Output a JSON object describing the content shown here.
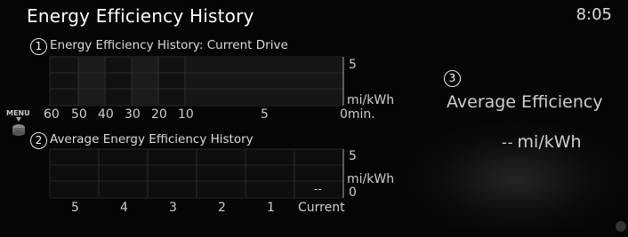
{
  "header": {
    "title": "Energy Efficiency History",
    "clock": "8:05"
  },
  "menu": {
    "label": "MENU",
    "icon": "commander-knob-icon"
  },
  "current_drive": {
    "badge": "1",
    "title": "Energy Efficiency History: Current Drive",
    "y_max": "5",
    "unit": "mi/kWh",
    "x_labels": [
      "60",
      "50",
      "40",
      "30",
      "20",
      "10",
      "5",
      "0min."
    ]
  },
  "average_history": {
    "badge": "2",
    "title": "Average Energy Efficiency History",
    "y_max": "5",
    "unit": "mi/kWh",
    "y_min": "0",
    "current_value": "--",
    "x_labels": [
      "5",
      "4",
      "3",
      "2",
      "1",
      "Current"
    ]
  },
  "average_efficiency": {
    "badge": "3",
    "title": "Average Efficiency",
    "value": "--",
    "unit": "mi/kWh"
  },
  "chart_data": [
    {
      "type": "bar",
      "title": "Energy Efficiency History: Current Drive",
      "categories": [
        "60",
        "50",
        "40",
        "30",
        "20",
        "10",
        "5",
        "0min."
      ],
      "values": [],
      "ylabel": "mi/kWh",
      "ylim": [
        0,
        5
      ],
      "grid": true
    },
    {
      "type": "bar",
      "title": "Average Energy Efficiency History",
      "categories": [
        "5",
        "4",
        "3",
        "2",
        "1",
        "Current"
      ],
      "values": [],
      "ylabel": "mi/kWh",
      "ylim": [
        0,
        5
      ],
      "grid": true
    }
  ]
}
